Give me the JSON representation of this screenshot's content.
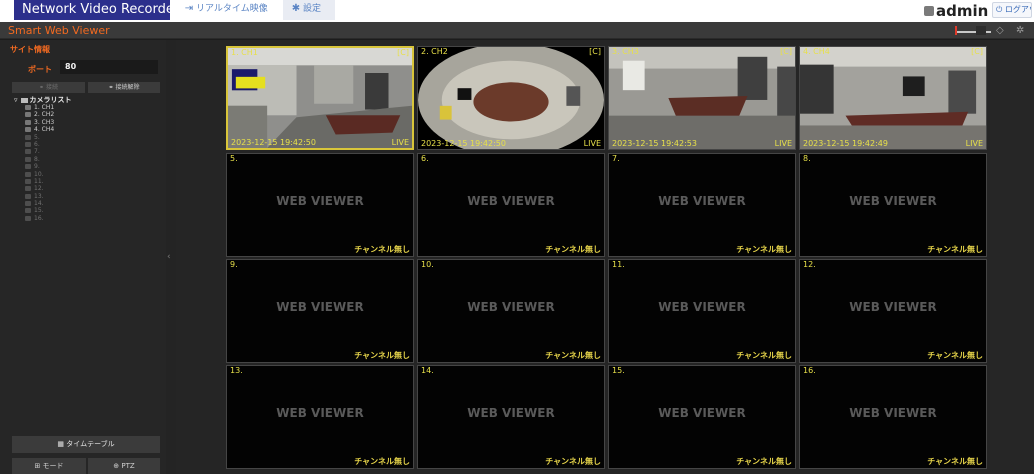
{
  "header": {
    "brand": "Network Video Recorder",
    "tab_live_label": "リアルタイム映像",
    "tab_settings_label": "設定",
    "username": "admin",
    "logout_label": "ログアウト"
  },
  "titlebar": {
    "title": "Smart Web Viewer"
  },
  "sidebar": {
    "section_title": "サイト情報",
    "port_label": "ポート",
    "port_value": "80",
    "connect_label": "接続",
    "disconnect_label": "接続解除",
    "camera_list_label": "カメラリスト",
    "cameras": [
      "1. CH1",
      "2. CH2",
      "3. CH3",
      "4. CH4",
      "5.",
      "6.",
      "7.",
      "8.",
      "9.",
      "10.",
      "11.",
      "12.",
      "13.",
      "14.",
      "15.",
      "16."
    ],
    "timetable_label": "タイムテーブル",
    "mode_label": "モード",
    "ptz_label": "PTZ"
  },
  "grid": {
    "live_tiles": [
      {
        "label": "1. CH1",
        "badge": "[C]",
        "timestamp": "2023-12-15 19:42:50",
        "status": "LIVE"
      },
      {
        "label": "2. CH2",
        "badge": "[C]",
        "timestamp": "2023-12-15 19:42:50",
        "status": "LIVE"
      },
      {
        "label": "3. CH3",
        "badge": "[C]",
        "timestamp": "2023-12-15 19:42:53",
        "status": "LIVE"
      },
      {
        "label": "4. CH4",
        "badge": "[C]",
        "timestamp": "2023-12-15 19:42:49",
        "status": "LIVE"
      }
    ],
    "empty_tiles": [
      "5.",
      "6.",
      "7.",
      "8.",
      "9.",
      "10.",
      "11.",
      "12.",
      "13.",
      "14.",
      "15.",
      "16."
    ],
    "empty_watermark": "WEB VIEWER",
    "no_channel_text": "チャンネル無し"
  },
  "colors": {
    "accent_orange": "#f26a21",
    "overlay_yellow": "#e7e04a",
    "selected_border": "#d8c53a",
    "brand_blue": "#2c2f8c"
  }
}
